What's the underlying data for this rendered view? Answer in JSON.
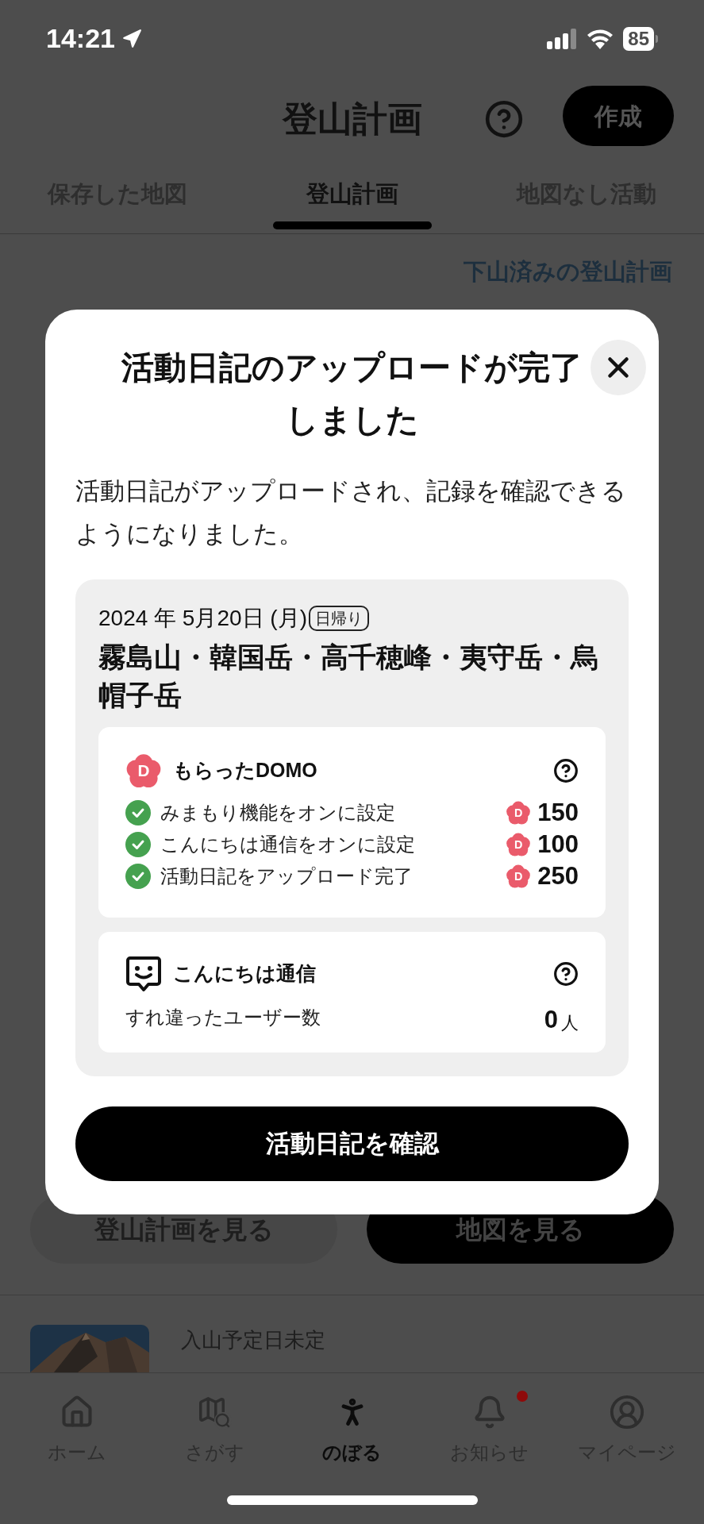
{
  "status_bar": {
    "time": "14:21",
    "battery": "85"
  },
  "header": {
    "title": "登山計画",
    "create_button": "作成"
  },
  "tabs": [
    {
      "label": "保存した地図",
      "selected": false
    },
    {
      "label": "登山計画",
      "selected": true
    },
    {
      "label": "地図なし活動",
      "selected": false
    }
  ],
  "archive_link": "下山済みの登山計画",
  "modal": {
    "title": "活動日記のアップロードが完了しました",
    "message": "活動日記がアップロードされ、記録を確認できるようになりました。",
    "activity": {
      "date": "2024 年 5月20日 (月)",
      "badge": "日帰り",
      "mountains": "霧島山・韓国岳・高千穂峰・夷守岳・烏帽子岳",
      "domo": {
        "mark": "D",
        "title": "もらったDOMO",
        "items": [
          {
            "label": "みまもり機能をオンに設定",
            "checked": true,
            "mark": "D",
            "points": "150"
          },
          {
            "label": "こんにちは通信をオンに設定",
            "checked": true,
            "mark": "D",
            "points": "100"
          },
          {
            "label": "活動日記をアップロード完了",
            "checked": true,
            "mark": "D",
            "points": "250"
          }
        ]
      },
      "hello": {
        "title": "こんにちは通信",
        "label": "すれ違ったユーザー数",
        "count": "0",
        "unit": "人"
      }
    },
    "button": "活動日記を確認"
  },
  "plan_buttons": [
    "登山計画を見る",
    "地図を見る"
  ],
  "next_plan": {
    "date": "入山予定日未定"
  },
  "nav": [
    {
      "kind": "home",
      "label": "ホーム",
      "selected": false,
      "badge": false
    },
    {
      "kind": "search",
      "label": "さがす",
      "selected": false,
      "badge": false
    },
    {
      "kind": "climb",
      "label": "のぼる",
      "selected": true,
      "badge": false
    },
    {
      "kind": "notice",
      "label": "お知らせ",
      "selected": false,
      "badge": true
    },
    {
      "kind": "mypage",
      "label": "マイページ",
      "selected": false,
      "badge": false
    }
  ]
}
